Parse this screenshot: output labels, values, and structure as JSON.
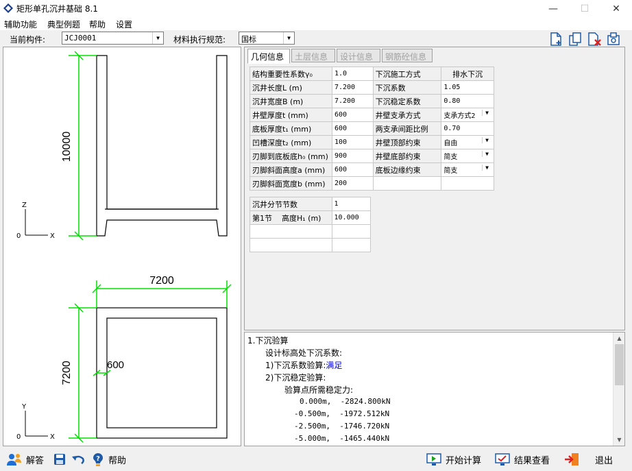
{
  "window": {
    "title": "矩形单孔沉井基础 8.1"
  },
  "menu": [
    "辅助功能",
    "典型例题",
    "帮助",
    "设置"
  ],
  "toolbar": {
    "component_label": "当前构件:",
    "component_value": "JCJ0001",
    "spec_label": "材料执行规范:",
    "spec_value": "国标"
  },
  "tabs": [
    "几何信息",
    "土层信息",
    "设计信息",
    "钢筋砼信息"
  ],
  "geometry_table": [
    [
      "结构重要性系数γ₀",
      "1.0",
      "下沉施工方式",
      "排水下沉"
    ],
    [
      "沉井长度L (m)",
      "7.200",
      "下沉系数",
      "1.05"
    ],
    [
      "沉井宽度B (m)",
      "7.200",
      "下沉稳定系数",
      "0.80"
    ],
    [
      "井壁厚度t (mm)",
      "600",
      "井壁支承方式",
      "支承方式2"
    ],
    [
      "底板厚度t₁ (mm)",
      "600",
      "两支承间距比例",
      "0.70"
    ],
    [
      "凹槽深度t₂ (mm)",
      "100",
      "井壁顶部约束",
      "自由"
    ],
    [
      "刃脚到底板底h₀ (mm)",
      "900",
      "井壁底部约束",
      "简支"
    ],
    [
      "刃脚斜面高度a (mm)",
      "600",
      "底板边缘约束",
      "简支"
    ],
    [
      "刃脚斜面宽度b (mm)",
      "200",
      "",
      ""
    ]
  ],
  "section_table": {
    "header_label": "沉井分节节数",
    "header_value": "1",
    "row1_name": "第1节",
    "row1_label": "高度H₁ (m)",
    "row1_value": "10.000"
  },
  "drawing": {
    "elev_dim": "10000",
    "plan_width_dim": "7200",
    "plan_height_dim": "7200",
    "wall_dim": "600",
    "axis_z": "Z",
    "axis_x": "X",
    "axis_y": "Y",
    "origin": "0"
  },
  "output": {
    "h1": "1.下沉验算",
    "l1": "设计标高处下沉系数:",
    "l2_prefix": "1)下沉系数验算:",
    "l2_status": "满足",
    "l3": "2)下沉稳定验算:",
    "l4": "验算点所需稳定力:",
    "rows": [
      "0.000m,  -2824.800kN",
      "-0.500m,  -1972.512kN",
      "-2.500m,  -1746.720kN",
      "-5.000m,  -1465.440kN"
    ]
  },
  "bottom": {
    "answer": "解答",
    "help": "帮助",
    "start": "开始计算",
    "result": "结果查看",
    "exit": "退出"
  },
  "colors": {
    "dim_green": "#00e000",
    "link_blue": "#0000ff"
  }
}
